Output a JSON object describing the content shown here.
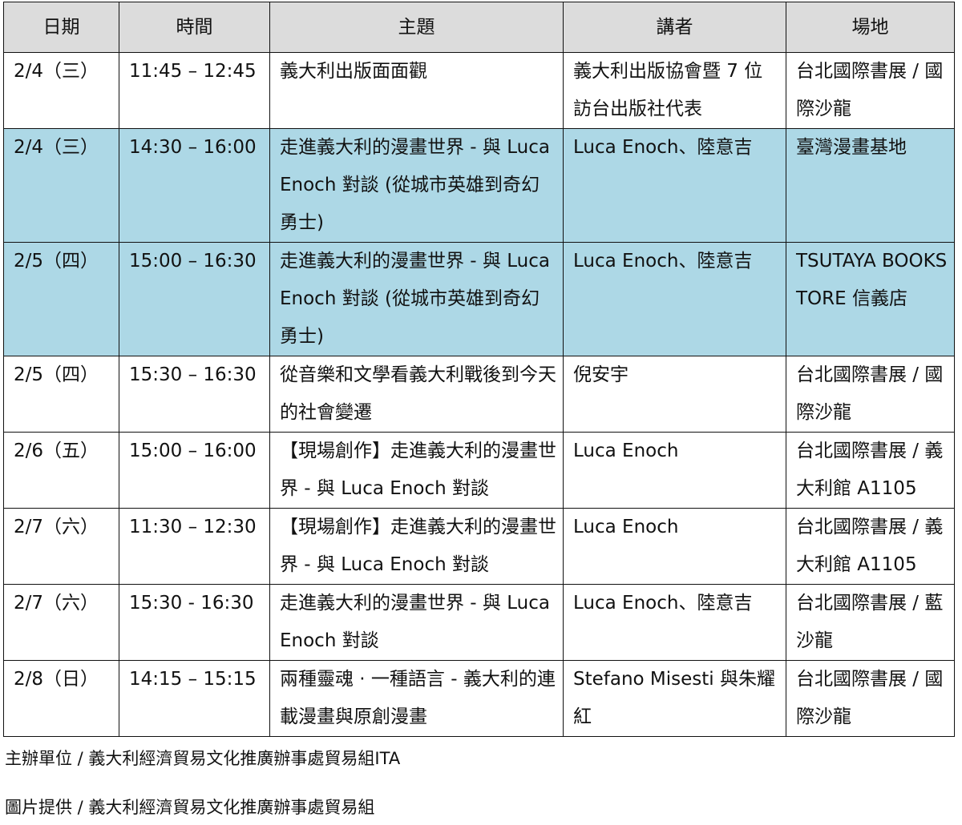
{
  "table": {
    "headers": [
      "日期",
      "時間",
      "主題",
      "講者",
      "場地"
    ],
    "rows": [
      {
        "date": "2/4（三）",
        "time": "11:45 – 12:45",
        "topic": "義大利出版面面觀",
        "speaker": "義大利出版協會暨 7 位訪台出版社代表",
        "venue": "台北國際書展 / 國際沙龍"
      },
      {
        "date": "2/4（三）",
        "time": "14:30 – 16:00",
        "topic": "走進義大利的漫畫世界 - 與 Luca Enoch 對談 (從城市英雄到奇幻勇士)",
        "speaker": "Luca Enoch、陸意吉",
        "venue": "臺灣漫畫基地"
      },
      {
        "date": "2/5（四）",
        "time": "15:00 – 16:30",
        "topic": "走進義大利的漫畫世界 - 與 Luca Enoch 對談 (從城市英雄到奇幻勇士)",
        "speaker": "Luca Enoch、陸意吉",
        "venue": "TSUTAYA BOOKSTORE 信義店"
      },
      {
        "date": "2/5（四）",
        "time": "15:30 – 16:30",
        "topic": "從音樂和文學看義大利戰後到今天的社會變遷",
        "speaker": "倪安宇",
        "venue": "台北國際書展 / 國際沙龍"
      },
      {
        "date": "2/6（五）",
        "time": "15:00 – 16:00",
        "topic": "【現場創作】走進義大利的漫畫世界 - 與 Luca Enoch 對談",
        "speaker": "Luca Enoch",
        "venue": "台北國際書展 / 義大利館 A1105"
      },
      {
        "date": "2/7（六）",
        "time": "11:30 – 12:30",
        "topic": "【現場創作】走進義大利的漫畫世界 - 與 Luca Enoch 對談",
        "speaker": "Luca Enoch",
        "venue": "台北國際書展 / 義大利館 A1105"
      },
      {
        "date": "2/7（六）",
        "time": "15:30 - 16:30",
        "topic": "走進義大利的漫畫世界 - 與 Luca Enoch 對談",
        "speaker": "Luca Enoch、陸意吉",
        "venue": "台北國際書展 / 藍沙龍"
      },
      {
        "date": "2/8（日）",
        "time": "14:15 – 15:15",
        "topic": "兩種靈魂 · 一種語言 - 義大利的連載漫畫與原創漫畫",
        "speaker": "Stefano Misesti 與朱耀紅",
        "venue": "台北國際書展 / 國際沙龍"
      }
    ]
  },
  "footer": {
    "organizer": "主辦單位 / 義大利經濟貿易文化推廣辦事處貿易組ITA",
    "photo_credit": "圖片提供 / 義大利經濟貿易文化推廣辦事處貿易組"
  },
  "colors": {
    "header_bg": "#dcdcdc",
    "highlight_bg": "#add8e6",
    "border": "#111111"
  }
}
